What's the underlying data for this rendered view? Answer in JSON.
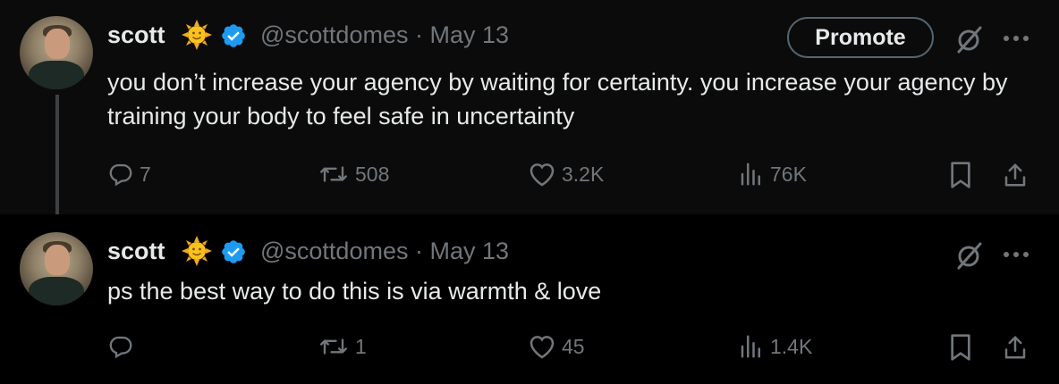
{
  "tweets": [
    {
      "name": "scott",
      "name_emoji": "sun-with-face",
      "verified": true,
      "handle": "@scottdomes",
      "separator": "·",
      "date": "May 13",
      "promote_label": "Promote",
      "text": "you don’t increase your agency by waiting for certainty. you increase your agency by training your body to feel safe in uncertainty",
      "actions": {
        "replies": "7",
        "reposts": "508",
        "likes": "3.2K",
        "views": "76K"
      }
    },
    {
      "name": "scott",
      "name_emoji": "sun-with-face",
      "verified": true,
      "handle": "@scottdomes",
      "separator": "·",
      "date": "May 13",
      "text": "ps the best way to do this is via warmth & love",
      "actions": {
        "replies": "",
        "reposts": "1",
        "likes": "45",
        "views": "1.4K"
      }
    }
  ],
  "colors": {
    "verified": "#1d9bf0",
    "muted": "#71767b",
    "text": "#e7e9ea"
  }
}
